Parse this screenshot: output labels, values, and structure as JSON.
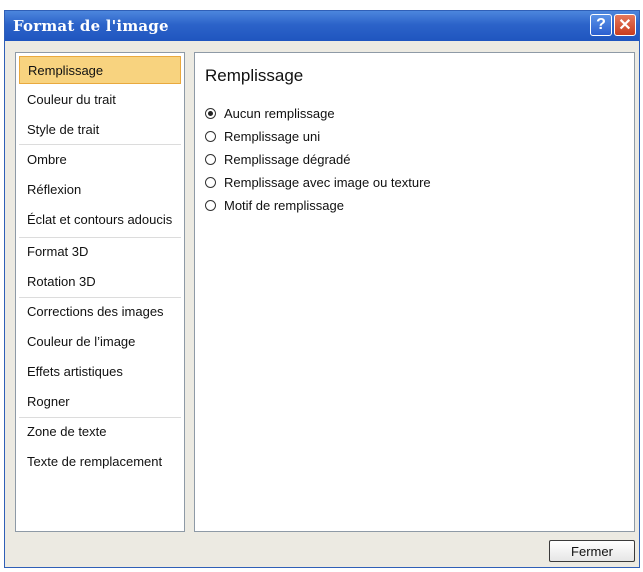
{
  "window": {
    "title": "Format de l'image",
    "help_glyph": "?",
    "close_glyph": "✕"
  },
  "sidebar": {
    "items": [
      {
        "label": "Remplissage",
        "selected": true
      },
      {
        "label": "Couleur du trait"
      },
      {
        "label": "Style de trait"
      },
      {
        "label": "Ombre"
      },
      {
        "label": "Réflexion"
      },
      {
        "label": "Éclat et contours adoucis"
      },
      {
        "label": "Format 3D"
      },
      {
        "label": "Rotation 3D"
      },
      {
        "label": "Corrections des images"
      },
      {
        "label": "Couleur de l’image"
      },
      {
        "label": "Effets artistiques"
      },
      {
        "label": "Rogner"
      },
      {
        "label": "Zone de texte"
      },
      {
        "label": "Texte de remplacement"
      }
    ]
  },
  "panel": {
    "title": "Remplissage",
    "options": [
      {
        "label": "Aucun remplissage",
        "checked": true
      },
      {
        "label": "Remplissage uni",
        "checked": false
      },
      {
        "label": "Remplissage dégradé",
        "checked": false
      },
      {
        "label": "Remplissage avec image ou texture",
        "checked": false
      },
      {
        "label": "Motif de remplissage",
        "checked": false
      }
    ]
  },
  "footer": {
    "close_label": "Fermer"
  }
}
